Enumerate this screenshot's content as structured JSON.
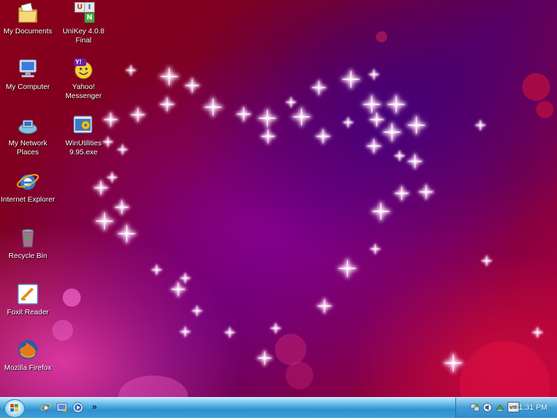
{
  "desktop": {
    "icons": [
      {
        "label": "My Documents"
      },
      {
        "label": "My Computer"
      },
      {
        "label": "My Network Places"
      },
      {
        "label": "Internet Explorer"
      },
      {
        "label": "Recycle Bin"
      },
      {
        "label": "Foxit Reader"
      },
      {
        "label": "Mozilla Firefox"
      },
      {
        "label": "UniKey 4.0.8 Final"
      },
      {
        "label": "Yahoo! Messenger"
      },
      {
        "label": "WinUtilities 9.95.exe"
      }
    ],
    "unikey_letters": [
      "U",
      "I",
      "N"
    ],
    "yahoo_letter": "Y!",
    "vm_text": "vm"
  },
  "taskbar": {
    "overflow_chevron": "»",
    "clock": "11:31 PM"
  },
  "colors": {
    "taskbar": "#3aa0d8",
    "desktop_base": "#7a0028"
  }
}
